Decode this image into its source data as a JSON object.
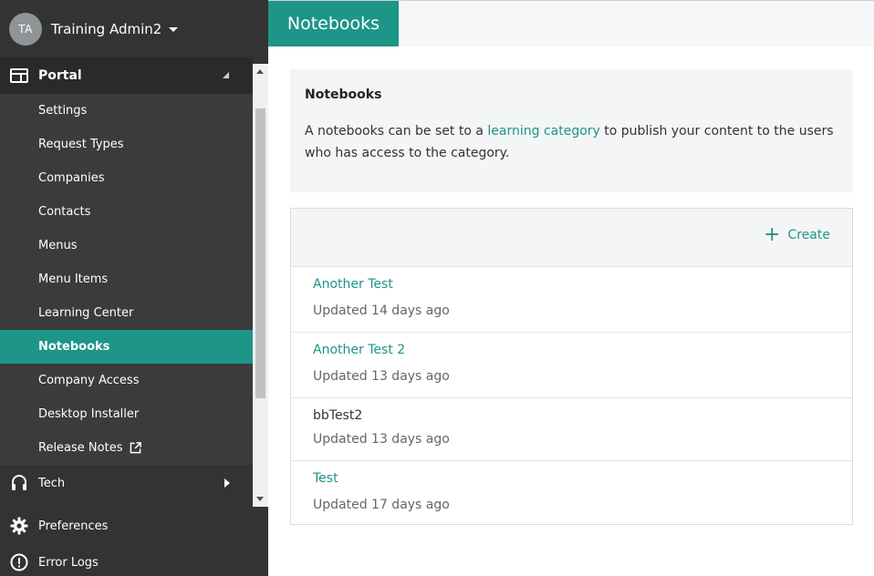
{
  "user": {
    "initials": "TA",
    "name": "Training Admin2"
  },
  "sidebar": {
    "section": {
      "label": "Portal",
      "icon": "portal-window-icon"
    },
    "sub_items": [
      {
        "label": "Settings",
        "active": false
      },
      {
        "label": "Request Types",
        "active": false
      },
      {
        "label": "Companies",
        "active": false
      },
      {
        "label": "Contacts",
        "active": false
      },
      {
        "label": "Menus",
        "active": false
      },
      {
        "label": "Menu Items",
        "active": false
      },
      {
        "label": "Learning Center",
        "active": false
      },
      {
        "label": "Notebooks",
        "active": true
      },
      {
        "label": "Company Access",
        "active": false
      },
      {
        "label": "Desktop Installer",
        "active": false
      },
      {
        "label": "Release Notes",
        "active": false,
        "icon": "external-link-icon"
      }
    ],
    "tech": {
      "label": "Tech",
      "icon": "headset-icon"
    },
    "preferences": {
      "label": "Preferences",
      "icon": "gear-icon"
    },
    "error_logs": {
      "label": "Error Logs",
      "icon": "exclamation-circle-icon"
    }
  },
  "header": {
    "tab_label": "Notebooks"
  },
  "info": {
    "title": "Notebooks",
    "text_before": "A notebooks can be set to a ",
    "link_text": "learning category",
    "text_after": " to publish your content to the users who has access to the category."
  },
  "list": {
    "create_label": "Create",
    "items": [
      {
        "title": "Another Test",
        "updated": "Updated 14 days ago",
        "is_link": true
      },
      {
        "title": "Another Test 2",
        "updated": "Updated 13 days ago",
        "is_link": true
      },
      {
        "title": "bbTest2",
        "updated": "Updated 13 days ago",
        "is_link": false
      },
      {
        "title": "Test",
        "updated": "Updated 17 days ago",
        "is_link": true
      }
    ]
  },
  "colors": {
    "accent": "#1d9587",
    "sidebar_bg": "#333333",
    "sidebar_sub_bg": "#3b3b3b"
  }
}
